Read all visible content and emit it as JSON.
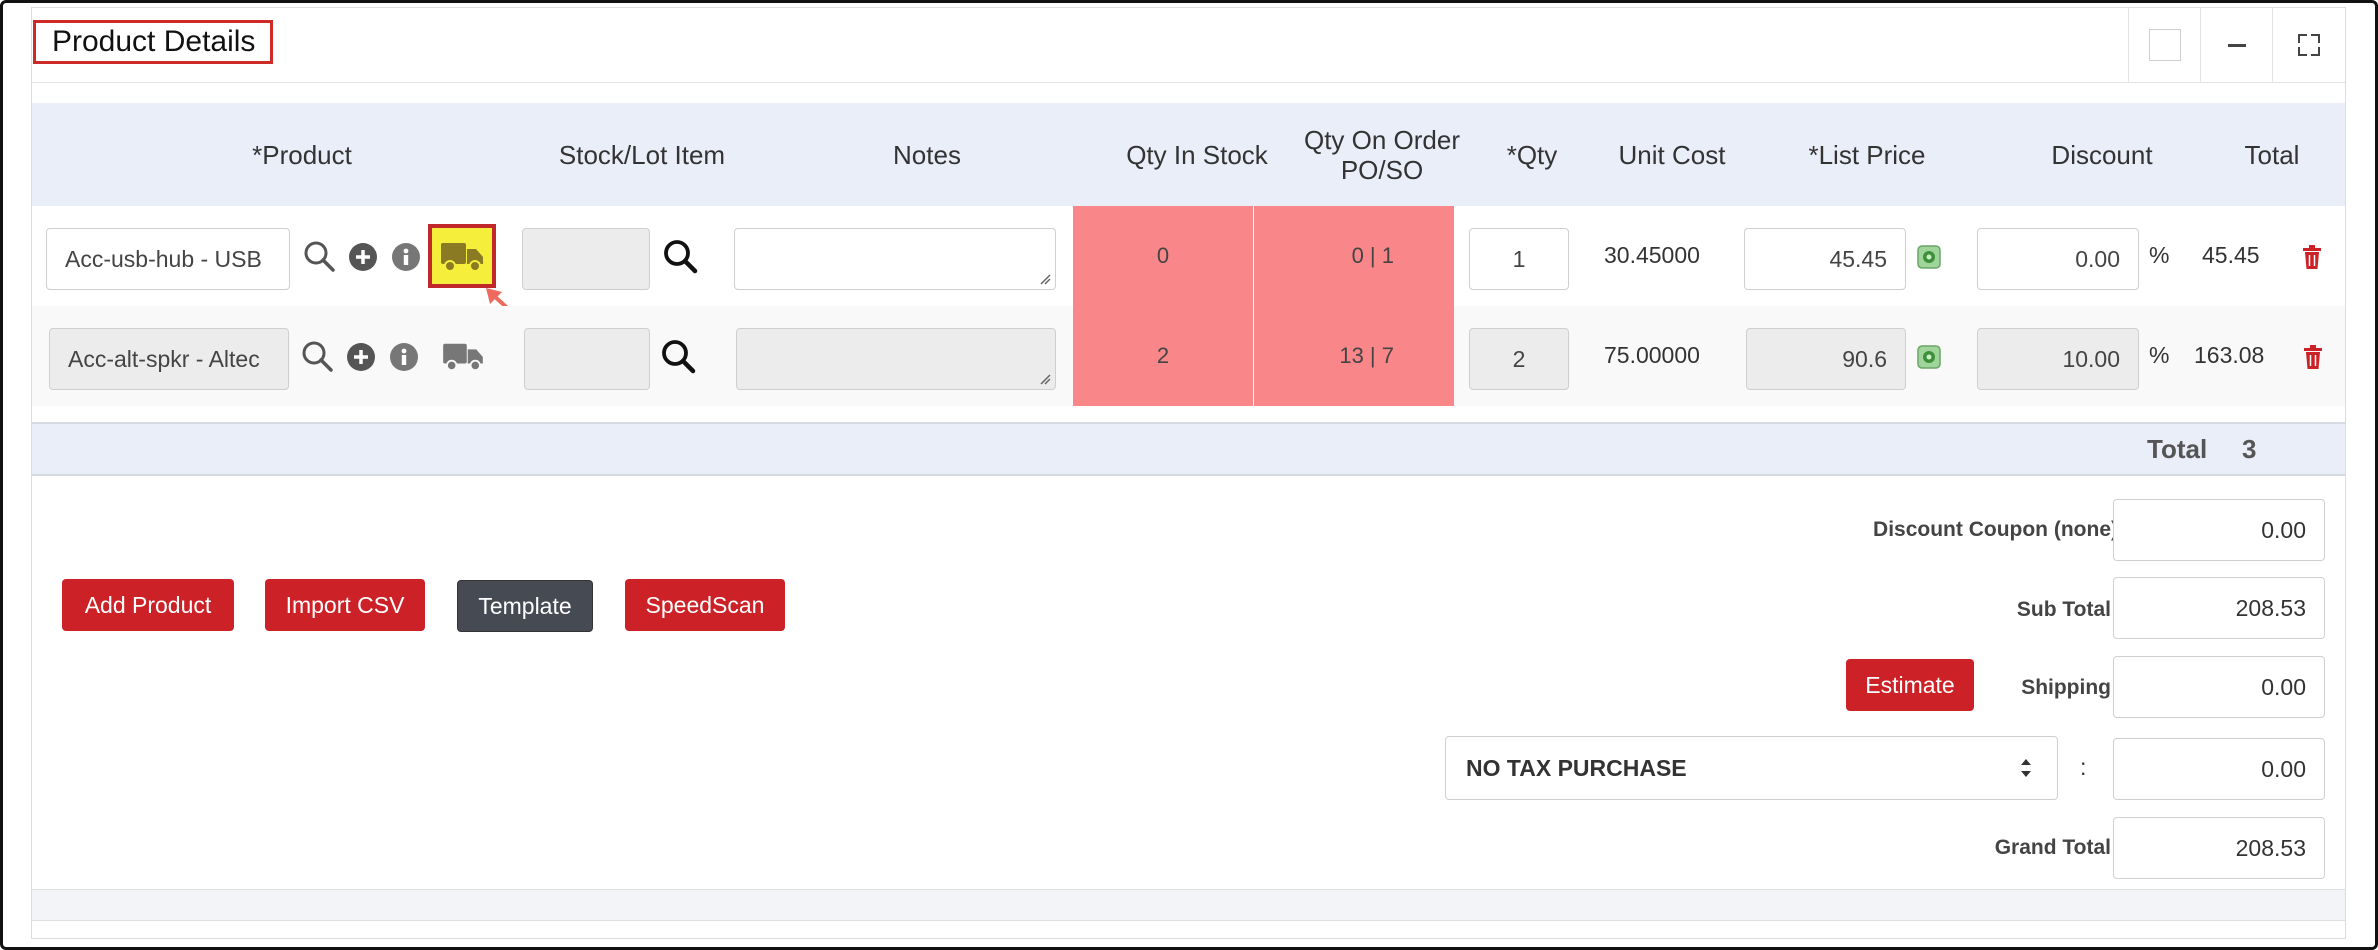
{
  "panel": {
    "title": "Product Details"
  },
  "table": {
    "headers": {
      "product": "*Product",
      "stock_lot": "Stock/Lot Item",
      "notes": "Notes",
      "qty_in_stock": "Qty In Stock",
      "qty_on_order_line1": "Qty On Order",
      "qty_on_order_line2": "PO/SO",
      "qty": "*Qty",
      "unit_cost": "Unit Cost",
      "list_price": "*List Price",
      "discount": "Discount",
      "total": "Total"
    },
    "rows": [
      {
        "product": "Acc-usb-hub - USB",
        "qty_in_stock": "0",
        "qty_on_order": "0 | 1",
        "qty": "1",
        "unit_cost": "30.45000",
        "list_price": "45.45",
        "discount": "0.00",
        "discount_unit": "%",
        "total": "45.45"
      },
      {
        "product": "Acc-alt-spkr - Altec",
        "qty_in_stock": "2",
        "qty_on_order": "13 | 7",
        "qty": "2",
        "unit_cost": "75.00000",
        "list_price": "90.6",
        "discount": "10.00",
        "discount_unit": "%",
        "total": "163.08"
      }
    ],
    "total_label": "Total",
    "total_qty": "3"
  },
  "buttons": {
    "add_product": "Add Product",
    "import_csv": "Import CSV",
    "template": "Template",
    "speedscan": "SpeedScan",
    "estimate": "Estimate"
  },
  "summary": {
    "discount_coupon_label": "Discount Coupon (none)",
    "discount_coupon_value": "0.00",
    "subtotal_label": "Sub Total:",
    "subtotal_value": "208.53",
    "shipping_label": "Shipping:",
    "shipping_value": "0.00",
    "tax_select": "NO TAX PURCHASE",
    "tax_colon": ":",
    "tax_value": "0.00",
    "grand_total_label": "Grand Total:",
    "grand_total_value": "208.53"
  },
  "colors": {
    "accent_red": "#cc2127",
    "stock_highlight": "#f9878a",
    "truck_highlight": "#f5ee3a",
    "header_bg": "#eaeef9"
  }
}
